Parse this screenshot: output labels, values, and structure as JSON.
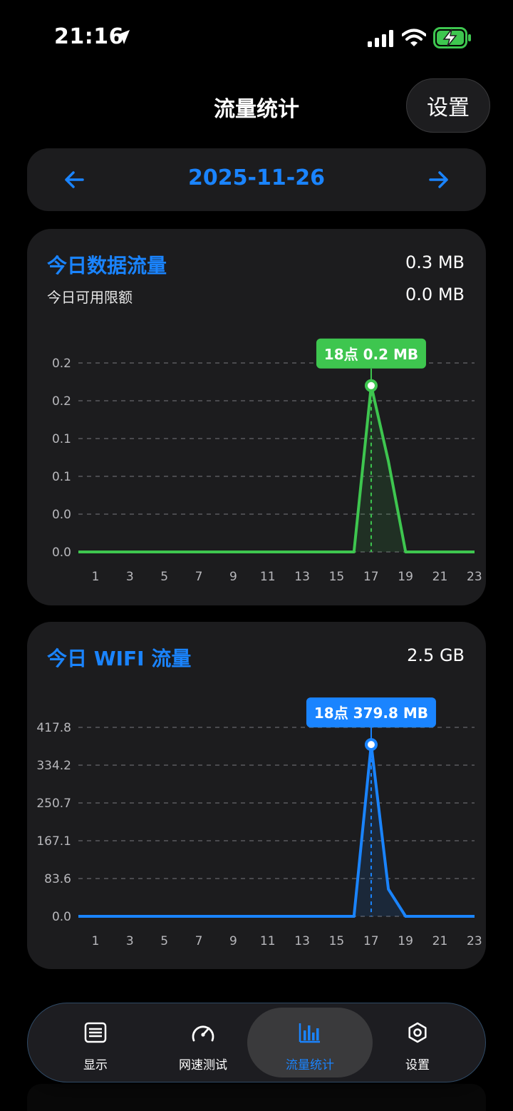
{
  "status": {
    "time": "21:16"
  },
  "nav": {
    "title": "流量统计",
    "settings_label": "设置"
  },
  "date_bar": {
    "date": "2025-11-26",
    "prev_icon": "arrow-left-icon",
    "next_icon": "arrow-right-icon"
  },
  "colors": {
    "accent": "#1a84ff",
    "green": "#3ec64f",
    "card": "#1c1c1e"
  },
  "mobile_card": {
    "title": "今日数据流量",
    "total": "0.3 MB",
    "limit_label": "今日可用限额",
    "limit_value": "0.0 MB",
    "tooltip": "18点 0.2 MB"
  },
  "wifi_card": {
    "title": "今日 WIFI 流量",
    "total": "2.5 GB",
    "tooltip": "18点 379.8 MB"
  },
  "chart_data": [
    {
      "type": "area",
      "color": "#3ec64f",
      "x": [
        1,
        2,
        3,
        4,
        5,
        6,
        7,
        8,
        9,
        10,
        11,
        12,
        13,
        14,
        15,
        16,
        17,
        18,
        19,
        20,
        21,
        22,
        23,
        24
      ],
      "x_ticks": [
        1,
        3,
        5,
        7,
        9,
        11,
        13,
        15,
        17,
        19,
        21,
        23
      ],
      "y_tick_labels": [
        "0.0",
        "0.0",
        "0.1",
        "0.1",
        "0.2",
        "0.2"
      ],
      "ylim": [
        0,
        0.25
      ],
      "values": [
        0,
        0,
        0,
        0,
        0,
        0,
        0,
        0,
        0,
        0,
        0,
        0,
        0,
        0,
        0,
        0,
        0,
        0.22,
        0.12,
        0,
        0,
        0,
        0,
        0
      ],
      "highlight_x": 18,
      "grid": true
    },
    {
      "type": "area",
      "color": "#1a84ff",
      "x": [
        1,
        2,
        3,
        4,
        5,
        6,
        7,
        8,
        9,
        10,
        11,
        12,
        13,
        14,
        15,
        16,
        17,
        18,
        19,
        20,
        21,
        22,
        23,
        24
      ],
      "x_ticks": [
        1,
        3,
        5,
        7,
        9,
        11,
        13,
        15,
        17,
        19,
        21,
        23
      ],
      "y_tick_labels": [
        "0.0",
        "83.6",
        "167.1",
        "250.7",
        "334.2",
        "417.8"
      ],
      "ylim": [
        0,
        417.8
      ],
      "values": [
        0,
        0,
        0,
        0,
        0,
        0,
        0,
        0,
        0,
        0,
        0,
        0,
        0,
        0,
        0,
        0,
        0,
        379.8,
        60,
        0,
        0,
        0,
        0,
        0
      ],
      "highlight_x": 18,
      "grid": true
    }
  ],
  "tabs": [
    {
      "label": "显示",
      "icon": "display-list-icon",
      "active": false
    },
    {
      "label": "网速测试",
      "icon": "speedometer-icon",
      "active": false
    },
    {
      "label": "流量统计",
      "icon": "bar-chart-icon",
      "active": true
    },
    {
      "label": "设置",
      "icon": "gear-icon",
      "active": false
    }
  ]
}
